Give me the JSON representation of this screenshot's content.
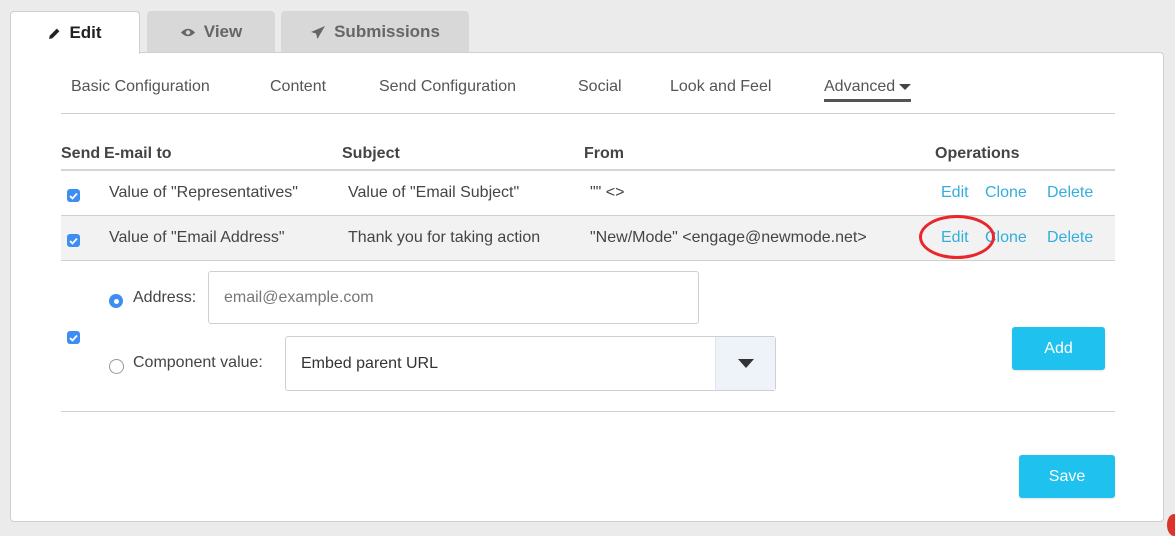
{
  "tabs": [
    {
      "label": "Edit",
      "icon": "pencil-icon",
      "active": true
    },
    {
      "label": "View",
      "icon": "eye-icon",
      "active": false
    },
    {
      "label": "Submissions",
      "icon": "paper-plane-icon",
      "active": false
    }
  ],
  "subnav": {
    "basic": "Basic Configuration",
    "content": "Content",
    "send": "Send Configuration",
    "social": "Social",
    "look": "Look and Feel",
    "advanced": "Advanced"
  },
  "table": {
    "headers": {
      "send": "Send",
      "email_to": "E-mail to",
      "subject": "Subject",
      "from": "From",
      "operations": "Operations"
    },
    "rows": [
      {
        "checked": true,
        "email_to": "Value of \"Representatives\"",
        "subject": "Value of \"Email Subject\"",
        "from": "\"\" <>",
        "edit": "Edit",
        "clone": "Clone",
        "delete": "Delete"
      },
      {
        "checked": true,
        "email_to": "Value of \"Email Address\"",
        "subject": "Thank you for taking action",
        "from": "\"New/Mode\" <engage@newmode.net>",
        "edit": "Edit",
        "clone": "Clone",
        "delete": "Delete"
      }
    ]
  },
  "new_row": {
    "checked": true,
    "address_label": "Address:",
    "address_placeholder": "email@example.com",
    "component_label": "Component value:",
    "component_selected": "Embed parent URL",
    "add_label": "Add"
  },
  "save_label": "Save",
  "colors": {
    "accent": "#1fc1ef",
    "link": "#33aedc",
    "checkbox": "#3e8df2",
    "highlight": "#e8262b"
  }
}
